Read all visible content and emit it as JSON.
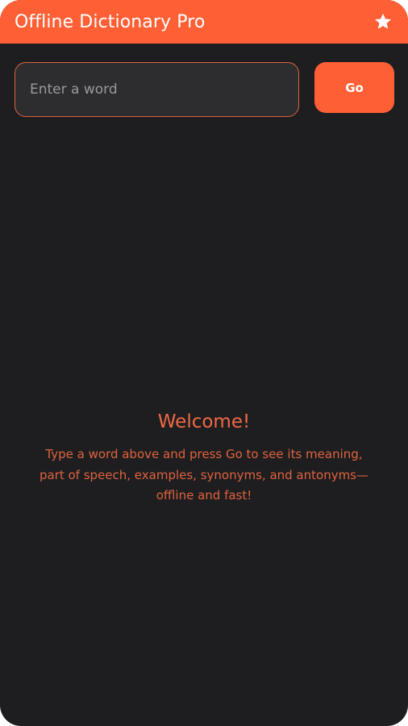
{
  "app": {
    "title": "Offline Dictionary Pro",
    "favorites_icon": "star-icon",
    "accent_color": "#ff5f35",
    "background_color": "#1e1e20"
  },
  "search": {
    "placeholder": "Enter a word",
    "value": "",
    "go_label": "Go"
  },
  "welcome": {
    "title": "Welcome!",
    "message": "Type a word above and press Go to see its meaning, part of speech, examples, synonyms, and antonyms—offline and fast!"
  }
}
